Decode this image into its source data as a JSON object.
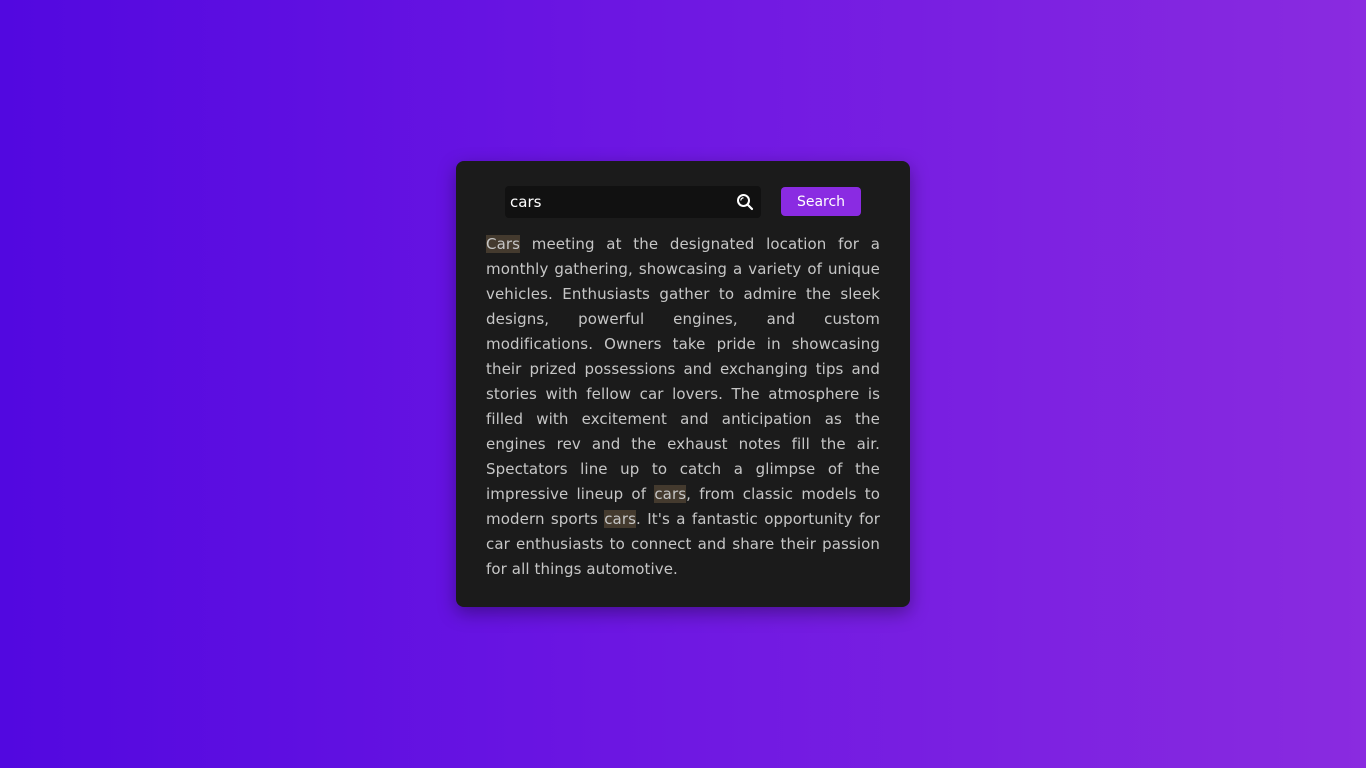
{
  "search": {
    "value": "cars",
    "button_label": "Search",
    "icon": "search-icon"
  },
  "article": {
    "segments": [
      {
        "text": "Cars",
        "highlight": true
      },
      {
        "text": " meeting at the designated location for a monthly gathering, showcasing a variety of unique vehicles. Enthusiasts gather to admire the sleek designs, powerful engines, and custom modifications. Owners take pride in showcasing their prized possessions and exchanging tips and stories with fellow car lovers. The atmosphere is filled with excitement and anticipation as the engines rev and the exhaust notes fill the air. Spectators line up to catch a glimpse of the impressive lineup of ",
        "highlight": false
      },
      {
        "text": "cars",
        "highlight": true
      },
      {
        "text": ", from classic models to modern sports ",
        "highlight": false
      },
      {
        "text": "cars",
        "highlight": true
      },
      {
        "text": ". It's a fantastic opportunity for car enthusiasts to connect and share their passion for all things automotive.",
        "highlight": false
      }
    ]
  },
  "colors": {
    "background_start": "#5208e0",
    "background_end": "#8a2be0",
    "card": "#1b1b1b",
    "input": "#111111",
    "accent": "#8a2be2",
    "highlight": "#443a2e",
    "text": "#c6c6c6"
  }
}
